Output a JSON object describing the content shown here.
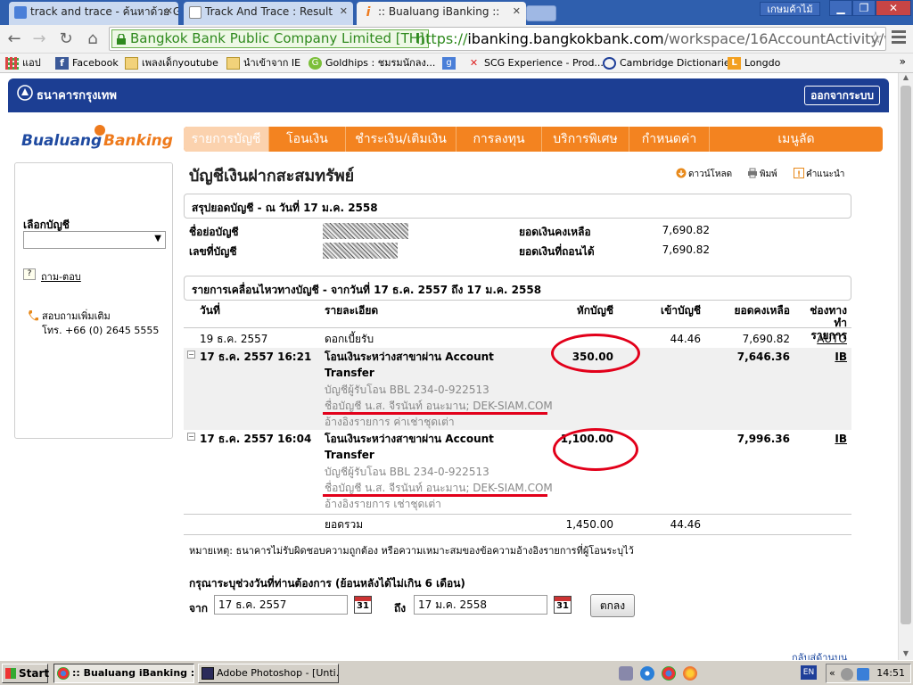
{
  "browser": {
    "tabs": [
      {
        "label": "track and trace - ค้นหาด้วย G",
        "active": false
      },
      {
        "label": "Track And Trace : Result",
        "active": false
      },
      {
        "label": ":: Bualuang iBanking ::",
        "active": true
      }
    ],
    "user_badge": "เกษมค้าไม้",
    "ev_cert": "Bangkok Bank Public Company Limited [TH]",
    "url_scheme": "https://",
    "url_host": "ibanking.bangkokbank.com",
    "url_path": "/workspace/16AccountActivity/wsp_",
    "bookmarks": [
      {
        "label": "แอป",
        "icon": "apps-grid-icon"
      },
      {
        "label": "Facebook",
        "icon": "facebook-icon"
      },
      {
        "label": "เพลงเด็กyoutube",
        "icon": "folder-icon"
      },
      {
        "label": "นำเข้าจาก IE",
        "icon": "folder-icon"
      },
      {
        "label": "Goldhips : ชมรมนักลง...",
        "icon": "goldhips-icon"
      },
      {
        "label": "",
        "icon": "google-icon"
      },
      {
        "label": "SCG Experience - Prod...",
        "icon": "scg-icon"
      },
      {
        "label": "Cambridge Dictionaries",
        "icon": "cambridge-icon"
      },
      {
        "label": "Longdo",
        "icon": "longdo-icon"
      }
    ],
    "bookmarks_more": "»"
  },
  "bank": {
    "logo_text": "ธนาคารกรุงเทพ",
    "logout": "ออกจากระบบ",
    "ibank_logo_1": "Bualuang",
    "ibank_logo_2": "Banking",
    "nav": [
      "รายการบัญชี",
      "โอนเงิน",
      "ชำระเงิน/เติมเงิน",
      "การลงทุน",
      "บริการพิเศษ",
      "กำหนดค่า",
      "เมนูลัด"
    ],
    "sidebar": {
      "select_label": "เลือกบัญชี",
      "select_value": "",
      "qa_link": "ถาม-ตอบ",
      "contact_line1": "สอบถามเพิ่มเติม",
      "contact_line2": "โทร. +66 (0) 2645 5555"
    },
    "page_title": "บัญชีเงินฝากสะสมทรัพย์",
    "actions": {
      "download": "ดาวน์โหลด",
      "print": "พิมพ์",
      "help": "คำแนะนำ"
    },
    "summary": {
      "header": "สรุปยอดบัญชี - ณ วันที่ 17 ม.ค. 2558",
      "name_label": "ชื่อย่อบัญชี",
      "number_label": "เลขที่บัญชี",
      "balance_label": "ยอดเงินคงเหลือ",
      "balance_value": "7,690.82",
      "available_label": "ยอดเงินที่ถอนได้",
      "available_value": "7,690.82"
    },
    "activity": {
      "header": "รายการเคลื่อนไหวทางบัญชี - จากวันที่ 17 ธ.ค. 2557 ถึง 17 ม.ค. 2558",
      "columns": {
        "date": "วันที่",
        "desc": "รายละเอียด",
        "debit": "หักบัญชี",
        "credit": "เข้าบัญชี",
        "balance": "ยอดคงเหลือ",
        "channel_1": "ช่องทาง",
        "channel_2": "ทำรายการ"
      },
      "rows": [
        {
          "date": "19 ธ.ค. 2557",
          "desc_1": "ดอกเบี้ยรับ",
          "desc_2": "",
          "debit": "",
          "credit": "44.46",
          "balance": "7,690.82",
          "channel": "AUTO",
          "detail_1": "",
          "detail_2": "",
          "detail_3": ""
        },
        {
          "date": "17 ธ.ค. 2557 16:21",
          "desc_1": "โอนเงินระหว่างสาขาผ่าน Account",
          "desc_2": "Transfer",
          "debit": "350.00",
          "credit": "",
          "balance": "7,646.36",
          "channel": "IB",
          "detail_1": "บัญชีผู้รับโอน   BBL 234-0-922513",
          "detail_2": "ชื่อบัญชี   น.ส. จีรนันท์ อนะมาน; DEK-SIAM.COM",
          "detail_3": "อ้างอิงรายการ   ค่าเช่าชุดเต่า"
        },
        {
          "date": "17 ธ.ค. 2557 16:04",
          "desc_1": "โอนเงินระหว่างสาขาผ่าน Account",
          "desc_2": "Transfer",
          "debit": "1,100.00",
          "credit": "",
          "balance": "7,996.36",
          "channel": "IB",
          "detail_1": "บัญชีผู้รับโอน   BBL 234-0-922513",
          "detail_2": "ชื่อบัญชี   น.ส. จีรนันท์ อนะมาน; DEK-SIAM.COM",
          "detail_3": "อ้างอิงรายการ   เช่าชุดเต่า"
        }
      ],
      "total_label": "ยอดรวม",
      "total_debit": "1,450.00",
      "total_credit": "44.46"
    },
    "note": "หมายเหตุ: ธนาคารไม่รับผิดชอบความถูกต้อง หรือความเหมาะสมของข้อความอ้างอิงรายการที่ผู้โอนระบุไว้",
    "range": {
      "label": "กรุณาระบุช่วงวันที่ท่านต้องการ  (ย้อนหลังได้ไม่เกิน 6 เดือน)",
      "from_label": "จาก",
      "from_value": "17 ธ.ค. 2557",
      "to_label": "ถึง",
      "to_value": "17 ม.ค. 2558",
      "cal_day": "31",
      "ok": "ตกลง"
    },
    "back_to_top": "กลับสู่ด้านบน"
  },
  "taskbar": {
    "start": "Start",
    "items": [
      {
        "label": ":: Bualuang iBanking ::...",
        "active": true
      },
      {
        "label": "Adobe Photoshop - [Unti...",
        "active": false
      }
    ],
    "lang": "EN",
    "tray_more": "«",
    "clock": "14:51"
  },
  "colors": {
    "bank_blue": "#1c3e93",
    "bank_orange": "#f38320",
    "annotation_red": "#e2001a"
  }
}
